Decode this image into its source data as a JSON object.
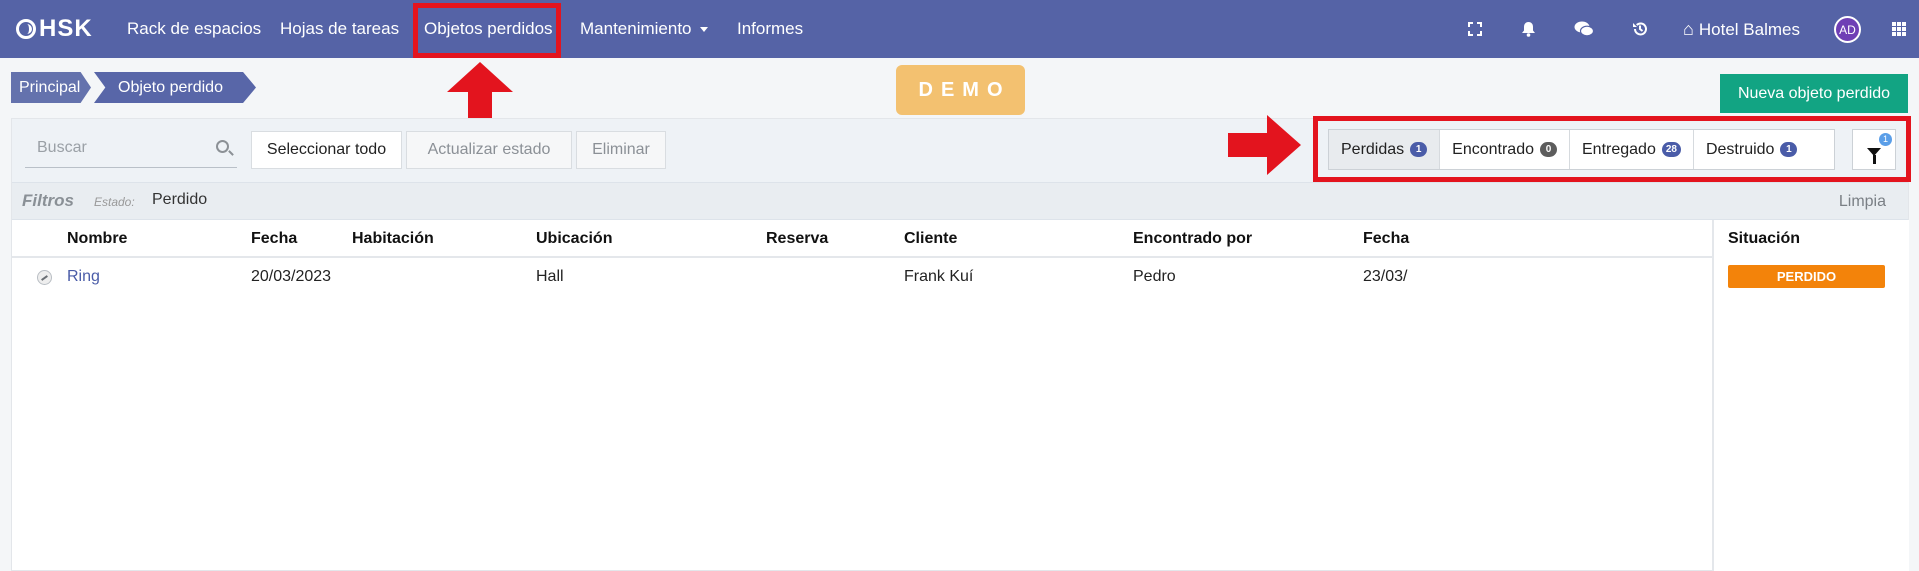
{
  "navbar": {
    "brand": "HSK",
    "items": [
      "Rack de espacios",
      "Hojas de tareas",
      "Objetos perdidos",
      "Mantenimiento",
      "Informes"
    ],
    "hotel": "Hotel Balmes",
    "avatar": "AD",
    "icons": [
      "fullscreen-icon",
      "bell-icon",
      "chat-icon",
      "history-icon",
      "home-icon",
      "apps-grid-icon"
    ]
  },
  "breadcrumb": [
    "Principal",
    "Objeto perdido"
  ],
  "demo_label": "DEMO",
  "new_button": "Nueva objeto perdido",
  "toolbar": {
    "search_placeholder": "Buscar",
    "select_all": "Seleccionar todo",
    "update_status": "Actualizar estado",
    "delete": "Eliminar"
  },
  "status_filters": [
    {
      "label": "Perdidas",
      "count": "1",
      "active": true
    },
    {
      "label": "Encontrado",
      "count": "0",
      "active": false
    },
    {
      "label": "Entregado",
      "count": "28",
      "active": false
    },
    {
      "label": "Destruido",
      "count": "1",
      "active": false
    }
  ],
  "filter_count": "1",
  "filters": {
    "title": "Filtros",
    "label": "Estado:",
    "value": "Perdido",
    "clear": "Limpia"
  },
  "table": {
    "columns": [
      "Nombre",
      "Fecha",
      "Habitación",
      "Ubicación",
      "Reserva",
      "Cliente",
      "Encontrado por",
      "Fecha",
      "Situación"
    ],
    "rows": [
      {
        "nombre": "Ring",
        "fecha": "20/03/2023",
        "habitacion": "",
        "ubicacion": "Hall",
        "reserva": "",
        "cliente": "Frank Kuí",
        "encontrado_por": "Pedro",
        "fecha2": "23/03/",
        "situacion": "PERDIDO"
      }
    ]
  },
  "colors": {
    "navbar": "#5563a6",
    "highlight_red": "#e3141e",
    "demo": "#f3c170",
    "new_button": "#12a483",
    "status_lost": "#f3830a",
    "badge_blue": "#4a5ca8"
  }
}
